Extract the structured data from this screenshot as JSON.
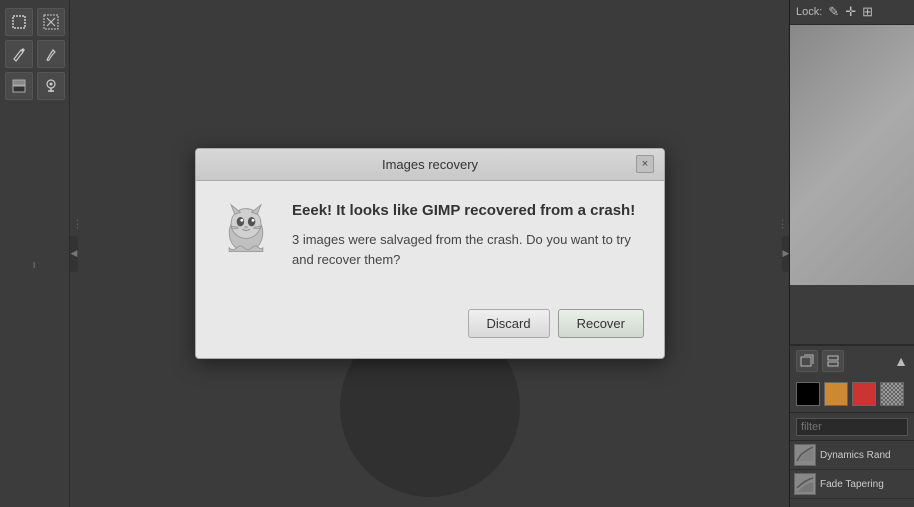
{
  "app": {
    "title": "GIMP"
  },
  "toolbar": {
    "tools": [
      {
        "name": "rect-select",
        "icon": "▣"
      },
      {
        "name": "move",
        "icon": "✛"
      },
      {
        "name": "pencil",
        "icon": "✏"
      },
      {
        "name": "paintbrush",
        "icon": "🖌"
      },
      {
        "name": "eraser",
        "icon": "◻"
      },
      {
        "name": "heal",
        "icon": "👤"
      }
    ]
  },
  "right_panel": {
    "lock_label": "Lock:",
    "filter_placeholder": "filter",
    "dynamics": [
      {
        "name": "Dynamics Rand",
        "thumb_color": "#888"
      },
      {
        "name": "Fade Tapering",
        "thumb_color": "#888"
      }
    ],
    "colors": [
      "#000000",
      "#cc4444",
      "#884444",
      "#ccaa44"
    ]
  },
  "modal": {
    "title": "Images recovery",
    "close_label": "×",
    "heading": "Eeek! It looks like GIMP recovered from a crash!",
    "body": "3 images were salvaged from the crash. Do you want to try and recover them?",
    "discard_label": "Discard",
    "recover_label": "Recover"
  }
}
